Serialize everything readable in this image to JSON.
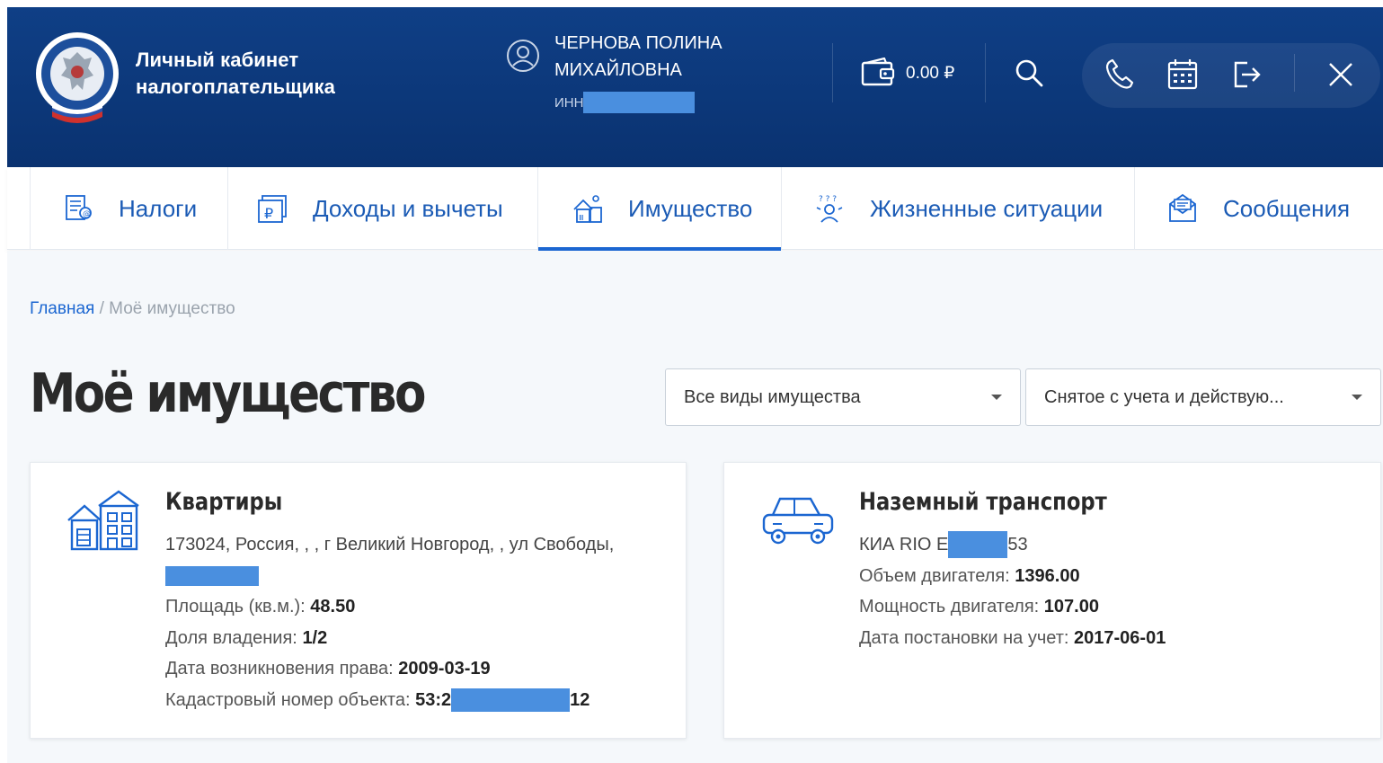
{
  "header": {
    "brand_line1": "Личный кабинет",
    "brand_line2": "налогоплательщика",
    "user_line1": "ЧЕРНОВА ПОЛИНА",
    "user_line2": "МИХАЙЛОВНА",
    "inn_label": "ИНН",
    "balance": "0.00 ₽",
    "icons": [
      "user-icon",
      "wallet-icon",
      "search-icon",
      "phone-icon",
      "calendar-icon",
      "logout-icon",
      "close-icon"
    ]
  },
  "nav": {
    "items": [
      {
        "label": "Налоги",
        "icon": "taxes-icon"
      },
      {
        "label": "Доходы и вычеты",
        "icon": "income-icon"
      },
      {
        "label": "Имущество",
        "icon": "property-icon",
        "active": true
      },
      {
        "label": "Жизненные ситуации",
        "icon": "life-situations-icon"
      },
      {
        "label": "Сообщения",
        "icon": "messages-icon"
      }
    ]
  },
  "breadcrumb": {
    "home": "Главная",
    "separator": " / ",
    "current": "Моё имущество"
  },
  "page": {
    "title": "Моё имущество"
  },
  "filters": {
    "property_type": "Все виды имущества",
    "status": "Снятое с учета и действую..."
  },
  "cards": {
    "apartments": {
      "title": "Квартиры",
      "address": "173024, Россия, , , г Великий Новгород, , ул Свободы,",
      "area_label": "Площадь (кв.м.): ",
      "area_value": "48.50",
      "share_label": "Доля владения: ",
      "share_value": "1/2",
      "right_date_label": "Дата возникновения права: ",
      "right_date_value": "2009-03-19",
      "cadastral_label": "Кадастровый номер объекта: ",
      "cadastral_prefix": "53:2",
      "cadastral_suffix": "12"
    },
    "transport": {
      "title": "Наземный транспорт",
      "vehicle_prefix": "КИА RIO Е",
      "vehicle_suffix": "53",
      "engine_volume_label": "Объем двигателя: ",
      "engine_volume_value": "1396.00",
      "engine_power_label": "Мощность двигателя: ",
      "engine_power_value": "107.00",
      "reg_date_label": "Дата постановки на учет: ",
      "reg_date_value": "2017-06-01"
    }
  },
  "colors": {
    "header_bg": "#0f3f86",
    "accent": "#1b66d1",
    "redaction": "#4a8fdf"
  }
}
